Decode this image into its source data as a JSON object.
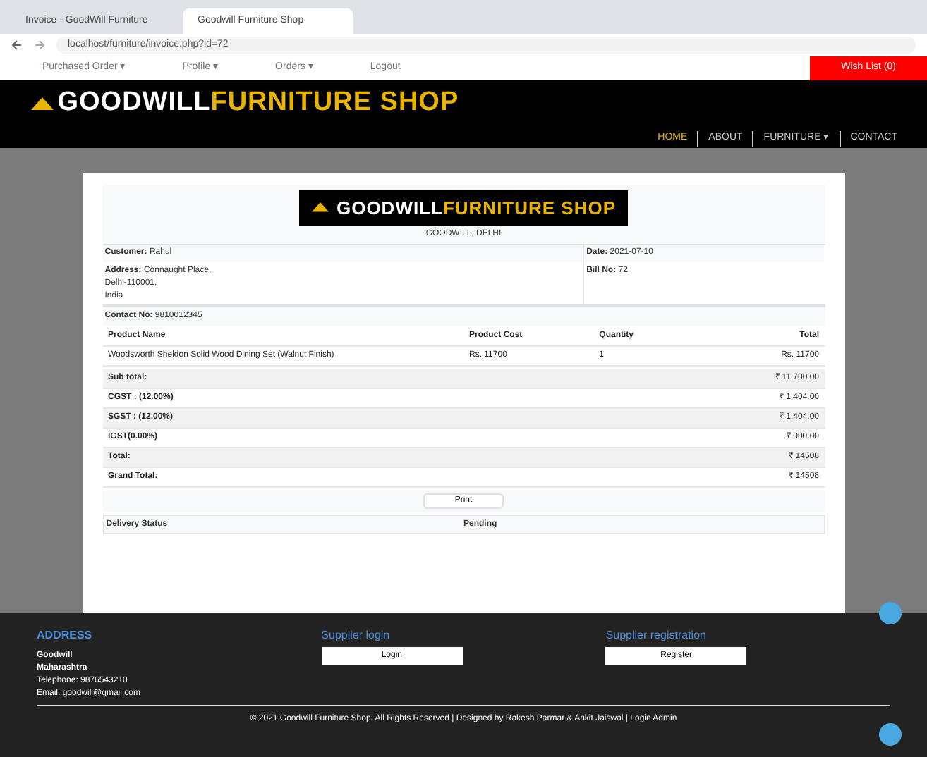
{
  "browser": {
    "tabs": [
      {
        "title": "Invoice - GoodWill Furniture",
        "selected": false
      },
      {
        "title": "Goodwill Furniture Shop",
        "selected": true
      }
    ],
    "url": "localhost/furniture/invoice.php?id=72"
  },
  "top_menu": {
    "items": [
      {
        "label": "Purchased Order ▾"
      },
      {
        "label": "Profile ▾"
      },
      {
        "label": "Orders ▾"
      },
      {
        "label": "Logout"
      }
    ],
    "cta": "Wish List (0)"
  },
  "header": {
    "logo_left": "GOODWILL",
    "logo_right": "FURNITURE SHOP",
    "nav": [
      {
        "label": "HOME",
        "selected": true
      },
      {
        "label": "ABOUT",
        "selected": false
      },
      {
        "label": "FURNITURE ▾",
        "selected": false
      },
      {
        "label": "CONTACT",
        "selected": false
      }
    ]
  },
  "invoice": {
    "logo_left": "GOODWILL",
    "logo_right": "FURNITURE SHOP",
    "subtitle": "GOODWILL, DELHI",
    "customer": {
      "label": "Customer:",
      "value": "Rahul"
    },
    "date": {
      "label": "Date:",
      "value": "2021-07-10"
    },
    "address": {
      "label": "Address:",
      "lines": [
        "Connaught Place,",
        "Delhi-110001,",
        "India"
      ]
    },
    "bill": {
      "label": "Bill No:",
      "value": "72"
    },
    "contact": {
      "label": "Contact No:",
      "value": "9810012345"
    },
    "columns": [
      "Product Name",
      "Product Cost",
      "Quantity",
      "Total"
    ],
    "rows": [
      [
        "Woodsworth Sheldon Solid Wood Dining Set (Walnut Finish)",
        "Rs. 11700",
        "1",
        "Rs. 11700"
      ]
    ],
    "summary": [
      {
        "label": "Sub total:",
        "value": "₹ 11,700.00"
      },
      {
        "label": "CGST : (12.00%)",
        "value": "₹ 1,404.00"
      },
      {
        "label": "SGST : (12.00%)",
        "value": "₹ 1,404.00"
      },
      {
        "label": "IGST(0.00%)",
        "value": "₹ 000.00"
      },
      {
        "label": "Total:",
        "value": "₹ 14508"
      },
      {
        "label": "Grand Total:",
        "value": "₹ 14508"
      }
    ],
    "print": "Print",
    "status": {
      "label": "Delivery Status",
      "value": "Pending"
    }
  },
  "footer": {
    "address_title": "ADDRESS",
    "address_lines": [
      "Goodwill",
      "Maharashtra",
      "Telephone: 9876543210",
      "Email: goodwill@gmail.com"
    ],
    "login_title": "Supplier login",
    "login_button": "Login",
    "register_title": "Supplier registration",
    "register_button": "Register",
    "copyright": "© 2021 Goodwill Furniture Shop. All Rights Reserved | Designed by Rakesh Parmar & Ankit Jaiswal | Login Admin"
  }
}
